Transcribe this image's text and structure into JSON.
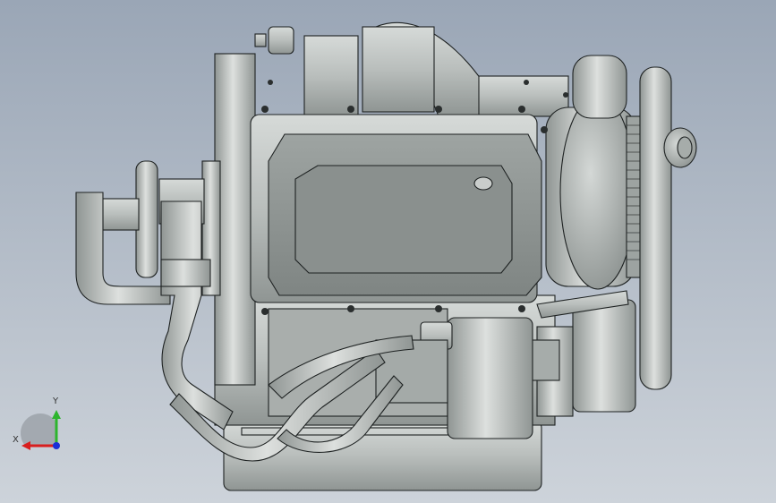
{
  "viewport": {
    "background_top": "#9aa6b6",
    "background_bottom": "#cdd3da",
    "model_fill": "#bfc4c2",
    "model_shadow": "#8e9492",
    "model_edge": "#1e2222"
  },
  "triad": {
    "x_label": "X",
    "y_label": "Y",
    "x_color": "#d81e1e",
    "y_color": "#2db52d",
    "z_color": "#1a2fd6"
  }
}
